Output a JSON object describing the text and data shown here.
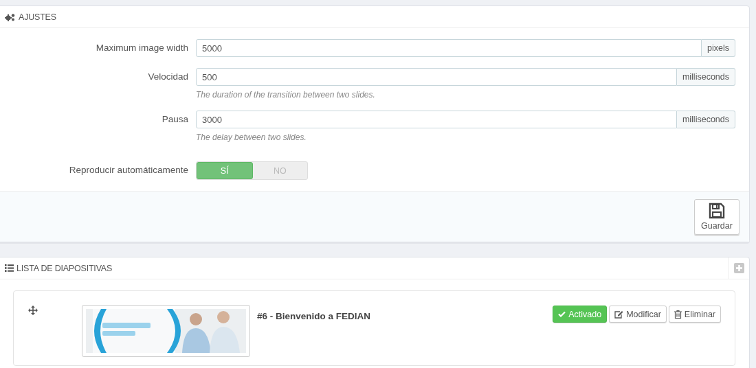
{
  "settings_panel": {
    "title": "AJUSTES",
    "fields": [
      {
        "label": "Maximum image width",
        "value": "5000",
        "unit": "pixels"
      },
      {
        "label": "Velocidad",
        "value": "500",
        "unit": "milliseconds",
        "help": "The duration of the transition between two slides."
      },
      {
        "label": "Pausa",
        "value": "3000",
        "unit": "milliseconds",
        "help": "The delay between two slides."
      }
    ],
    "autoplay": {
      "label": "Reproducir automáticamente",
      "options": [
        {
          "label": "SÍ",
          "selected": true
        },
        {
          "label": "NO",
          "selected": false
        }
      ]
    },
    "save_button": "Guardar"
  },
  "slides_panel": {
    "title": "LISTA DE DIAPOSITIVAS",
    "slides": [
      {
        "title": "#6 - Bienvenido a FEDIAN",
        "active": true,
        "status": "Activado",
        "edit": "Modificar",
        "delete": "Eliminar"
      }
    ]
  }
}
